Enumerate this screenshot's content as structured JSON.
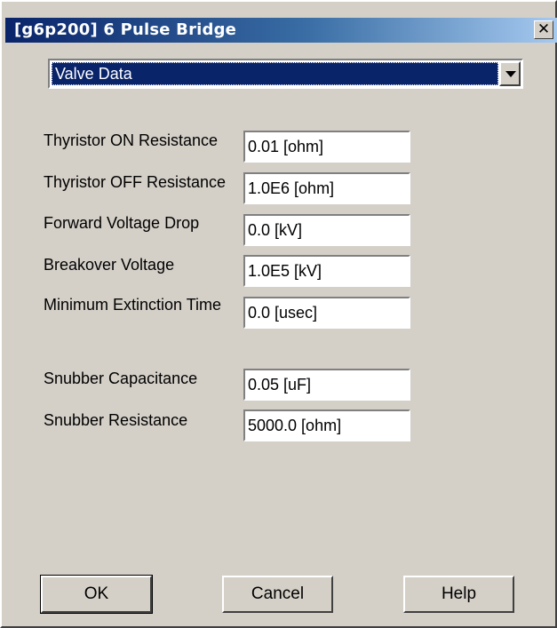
{
  "window": {
    "title": "[g6p200] 6 Pulse Bridge",
    "close_icon": "close-icon",
    "close_glyph": "✕"
  },
  "category_select": {
    "selected": "Valve Data"
  },
  "fields": [
    {
      "label": "Thyristor ON  Resistance",
      "value": "0.01 [ohm]"
    },
    {
      "label": "Thyristor OFF Resistance",
      "value": "1.0E6 [ohm]"
    },
    {
      "label": "Forward Voltage Drop",
      "value": "0.0 [kV]"
    },
    {
      "label": "Breakover Voltage",
      "value": "1.0E5 [kV]"
    },
    {
      "label": "Minimum Extinction Time",
      "value": "0.0 [usec]"
    },
    {
      "label": "Snubber Capacitance",
      "value": "0.05 [uF]"
    },
    {
      "label": "Snubber Resistance",
      "value": "5000.0 [ohm]"
    }
  ],
  "buttons": {
    "ok": "OK",
    "cancel": "Cancel",
    "help": "Help"
  },
  "colors": {
    "titlebar_start": "#0a246a",
    "titlebar_end": "#a6caf0",
    "dialog_face": "#d4d0c8",
    "selection": "#0a246a"
  }
}
